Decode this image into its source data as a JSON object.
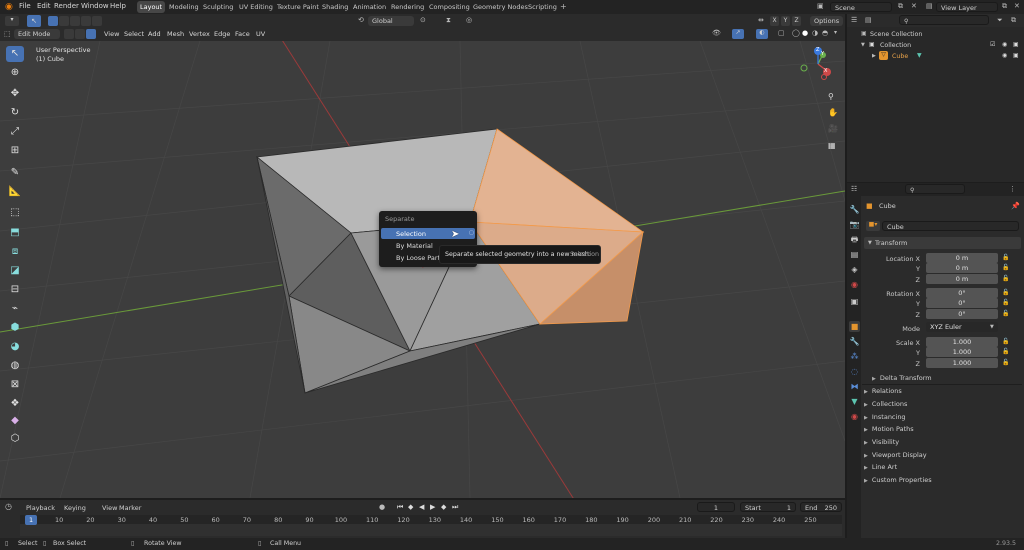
{
  "topbar": {
    "menus": [
      "File",
      "Edit",
      "Render",
      "Window",
      "Help"
    ],
    "workspaces": [
      "Layout",
      "Modeling",
      "Sculpting",
      "UV Editing",
      "Texture Paint",
      "Shading",
      "Animation",
      "Rendering",
      "Compositing",
      "Geometry Nodes",
      "Scripting"
    ],
    "active_workspace": "Layout",
    "scene": "Scene",
    "view_layer": "View Layer"
  },
  "tool_header": {
    "transform_orientation": "Global",
    "options_label": "Options",
    "axes": [
      "X",
      "Y",
      "Z"
    ]
  },
  "viewport": {
    "mode": "Edit Mode",
    "menus": [
      "View",
      "Select",
      "Add",
      "Mesh",
      "Vertex",
      "Edge",
      "Face",
      "UV"
    ],
    "perspective_label": "User Perspective",
    "object_label": "(1) Cube",
    "gizmo_axes": [
      "X",
      "Y",
      "Z"
    ]
  },
  "popup_menu": {
    "title": "Separate",
    "items": [
      {
        "label": "Selection",
        "highlighted": true
      },
      {
        "label": "By Material",
        "highlighted": false
      },
      {
        "label": "By Loose Parts",
        "highlighted": false
      }
    ]
  },
  "tooltip": {
    "text": "Separate selected geometry into a new mesh:",
    "value": "Selection"
  },
  "outliner": {
    "root": "Scene Collection",
    "collection": "Collection",
    "object": "Cube"
  },
  "properties": {
    "object_name": "Cube",
    "datablock_name": "Cube",
    "transform_header": "Transform",
    "location": {
      "label": "Location X",
      "x": "0 m",
      "y": "0 m",
      "z": "0 m"
    },
    "rotation": {
      "label": "Rotation X",
      "x": "0°",
      "y": "0°",
      "z": "0°"
    },
    "mode": {
      "label": "Mode",
      "value": "XYZ Euler"
    },
    "scale": {
      "label": "Scale X",
      "x": "1.000",
      "y": "1.000",
      "z": "1.000"
    },
    "axis_labels": [
      "Y",
      "Z"
    ],
    "delta_transform": "Delta Transform",
    "panels": [
      "Relations",
      "Collections",
      "Instancing",
      "Motion Paths",
      "Visibility",
      "Viewport Display",
      "Line Art",
      "Custom Properties"
    ]
  },
  "timeline": {
    "menus": [
      "Playback",
      "Keying",
      "View",
      "Marker"
    ],
    "current_frame": "1",
    "start_label": "Start",
    "start": "1",
    "end_label": "End",
    "end": "250",
    "frames": [
      "1",
      "10",
      "20",
      "30",
      "40",
      "50",
      "60",
      "70",
      "80",
      "90",
      "100",
      "110",
      "120",
      "130",
      "140",
      "150",
      "160",
      "170",
      "180",
      "190",
      "200",
      "210",
      "220",
      "230",
      "240",
      "250"
    ]
  },
  "statusbar": {
    "items": [
      "Select",
      "Box Select",
      "Rotate View",
      "Call Menu"
    ],
    "version": "2.93.5"
  },
  "colors": {
    "accent": "#4772b3",
    "selected_face": "#e3b392",
    "selected_edge": "#f39a4a",
    "x_axis": "#9a3a3a",
    "y_axis": "#6a9a3a"
  }
}
